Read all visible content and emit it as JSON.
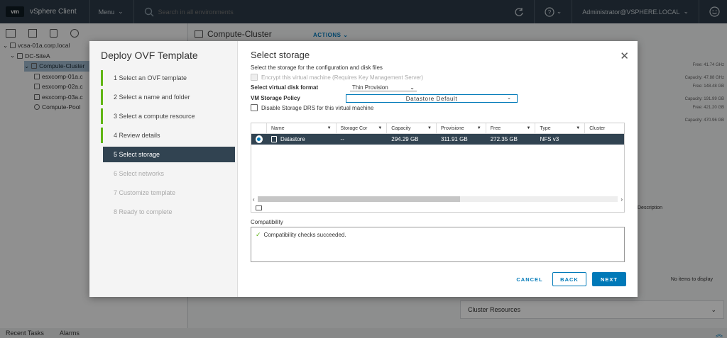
{
  "topbar": {
    "logo": "vm",
    "app_title": "vSphere Client",
    "menu_label": "Menu",
    "search_placeholder": "Search in all environments",
    "user": "Administrator@VSPHERE.LOCAL"
  },
  "inventory": {
    "tree": [
      {
        "label": "vcsa-01a.corp.local",
        "level": 0
      },
      {
        "label": "DC-SiteA",
        "level": 1
      },
      {
        "label": "Compute-Cluster",
        "level": 2,
        "selected": true
      },
      {
        "label": "esxcomp-01a.c",
        "level": 3
      },
      {
        "label": "esxcomp-02a.c",
        "level": 3
      },
      {
        "label": "esxcomp-03a.c",
        "level": 3
      },
      {
        "label": "Compute-Pool",
        "level": 3
      }
    ]
  },
  "background": {
    "object_title": "Compute-Cluster",
    "actions_label": "ACTIONS",
    "stats": [
      "Free: 41.74 GHz",
      "Capacity: 47.88 GHz",
      "Free: 148.48 GB",
      "Capacity: 191.99 GB",
      "Free: 421.20 GB",
      "Capacity: 470.96 GB"
    ],
    "description_header": "Description",
    "no_items": "No items to display",
    "cluster_resources": "Cluster Resources",
    "recent_tasks": "Recent Tasks",
    "alarms": "Alarms"
  },
  "wizard": {
    "title": "Deploy OVF Template",
    "steps": [
      {
        "label": "1  Select an OVF template",
        "state": "done"
      },
      {
        "label": "2  Select a name and folder",
        "state": "done"
      },
      {
        "label": "3  Select a compute resource",
        "state": "done"
      },
      {
        "label": "4  Review details",
        "state": "done"
      },
      {
        "label": "5  Select storage",
        "state": "active"
      },
      {
        "label": "6  Select networks",
        "state": "todo"
      },
      {
        "label": "7  Customize template",
        "state": "todo"
      },
      {
        "label": "8  Ready to complete",
        "state": "todo"
      }
    ],
    "section_title": "Select storage",
    "subtitle": "Select the storage for the configuration and disk files",
    "encrypt_label": "Encrypt this virtual machine (Requires Key Management Server)",
    "disk_format_label": "Select virtual disk format",
    "disk_format_value": "Thin Provision",
    "policy_label": "VM Storage Policy",
    "policy_value": "Datastore Default",
    "disable_drs_label": "Disable Storage DRS for this virtual machine",
    "table": {
      "columns": [
        "Name",
        "Storage Cor",
        "Capacity",
        "Provisione",
        "Free",
        "Type",
        "Cluster"
      ],
      "rows": [
        {
          "name": "Datastore",
          "storage_compat": "--",
          "capacity": "294.29 GB",
          "provisioned": "311.91 GB",
          "free": "272.35 GB",
          "type": "NFS v3",
          "cluster": ""
        }
      ]
    },
    "compat_label": "Compatibility",
    "compat_message": "Compatibility checks succeeded.",
    "cancel": "CANCEL",
    "back": "BACK",
    "next": "NEXT"
  }
}
